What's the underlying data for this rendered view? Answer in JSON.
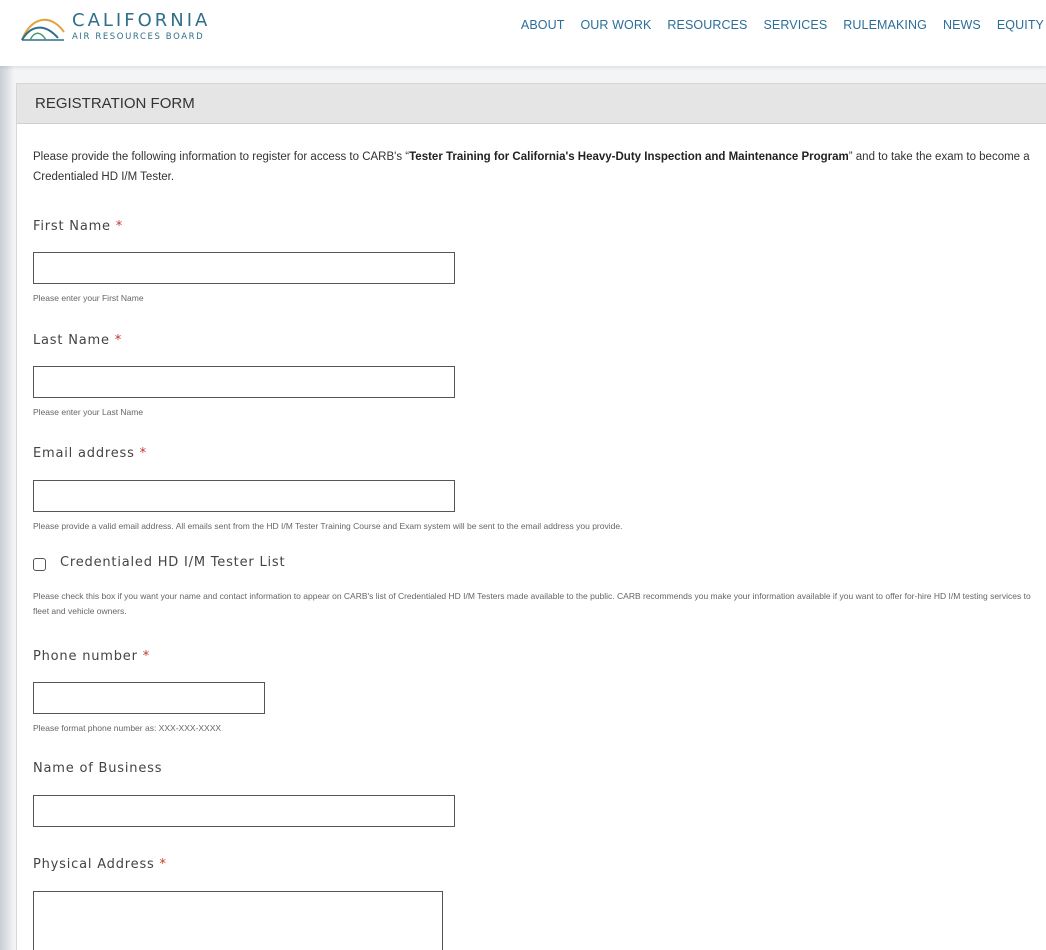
{
  "header": {
    "logo_main": "CALIFORNIA",
    "logo_sub": "AIR RESOURCES BOARD",
    "nav": [
      "ABOUT",
      "OUR WORK",
      "RESOURCES",
      "SERVICES",
      "RULEMAKING",
      "NEWS",
      "EQUITY"
    ]
  },
  "form": {
    "title": "REGISTRATION FORM",
    "intro_prefix": "Please provide the following information to register for access to CARB's “",
    "intro_bold": "Tester Training for California's Heavy-Duty Inspection and Maintenance Program",
    "intro_suffix": "” and to take the exam to become a Credentialed HD I/M Tester.",
    "required_mark": "*",
    "first_name": {
      "label": "First Name",
      "value": "",
      "help": "Please enter your First Name"
    },
    "last_name": {
      "label": "Last Name",
      "value": "",
      "help": "Please enter your Last Name"
    },
    "email": {
      "label": "Email address",
      "value": "",
      "help": "Please provide a valid email address. All emails sent from the HD I/M Tester Training Course and Exam system will be sent to the email address you provide."
    },
    "tester_list": {
      "label": "Credentialed HD I/M Tester List",
      "checked": false,
      "help": "Please check this box if you want your name and contact information to appear on CARB's list of Credentialed HD I/M Testers made available to the public. CARB recommends you make your information available if you want to offer for-hire HD I/M testing services to fleet and vehicle owners."
    },
    "phone": {
      "label": "Phone number",
      "value": "",
      "help": "Please format phone number as: XXX-XXX-XXXX"
    },
    "business": {
      "label": "Name of Business",
      "value": ""
    },
    "address": {
      "label": "Physical Address",
      "value": ""
    }
  },
  "colors": {
    "nav_link": "#2b6e9a",
    "logo": "#2f6f8a",
    "required": "#c0392b",
    "header_bar": "#e5e5e5"
  }
}
